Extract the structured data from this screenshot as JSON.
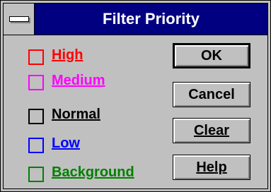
{
  "window": {
    "title": "Filter Priority"
  },
  "priorities": [
    {
      "label": "High",
      "color": "#ff0000",
      "checked": false
    },
    {
      "label": "Medium",
      "color": "#ff00ff",
      "checked": false
    },
    {
      "label": "Normal",
      "color": "#000000",
      "checked": false
    },
    {
      "label": "Low",
      "color": "#0000ff",
      "checked": false
    },
    {
      "label": "Background",
      "color": "#008000",
      "checked": false
    }
  ],
  "buttons": {
    "ok": "OK",
    "cancel": "Cancel",
    "clear": "Clear",
    "help": "Help"
  },
  "colors": {
    "title_bar": "#000080",
    "face": "#c0c0c0"
  }
}
